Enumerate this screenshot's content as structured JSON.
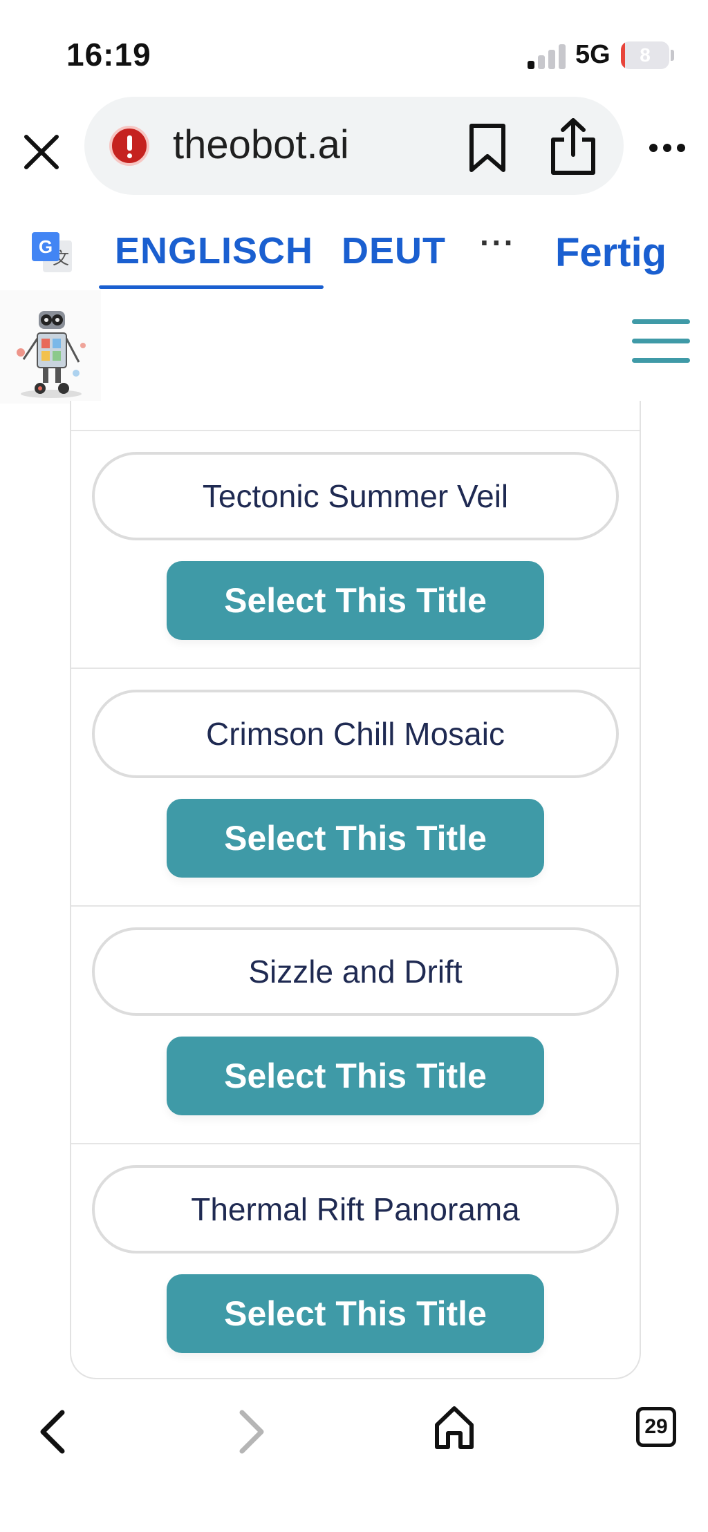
{
  "status_bar": {
    "time": "16:19",
    "network": "5G",
    "battery": "8",
    "battery_level": 0.08,
    "signal_bars_active": 1,
    "signal_bars_total": 4
  },
  "browser": {
    "url": "theobot.ai",
    "close_icon": "close-icon",
    "security_icon": "alert-icon",
    "bookmark_icon": "bookmark-icon",
    "share_icon": "share-icon",
    "more_icon": "more-horizontal-icon"
  },
  "translate_bar": {
    "icon": "google-translate-icon",
    "tabs": [
      {
        "label": "ENGLISCH",
        "active": true
      },
      {
        "label": "DEUT",
        "active": false
      }
    ],
    "more": "···",
    "done": "Fertig"
  },
  "site_header": {
    "logo": "robot-logo",
    "menu_icon": "hamburger-menu-icon"
  },
  "titles": [
    {
      "name": "Tectonic Summer Veil",
      "button": "Select This Title"
    },
    {
      "name": "Crimson Chill Mosaic",
      "button": "Select This Title"
    },
    {
      "name": "Sizzle and Drift",
      "button": "Select This Title"
    },
    {
      "name": "Thermal Rift Panorama",
      "button": "Select This Title"
    }
  ],
  "bottom_nav": {
    "back_icon": "back-chevron-icon",
    "forward_icon": "forward-chevron-icon",
    "home_icon": "home-icon",
    "tab_count": "29"
  },
  "colors": {
    "accent": "#3f9aa7",
    "translate_blue": "#1a5fd0",
    "title_text": "#1f2a52"
  }
}
